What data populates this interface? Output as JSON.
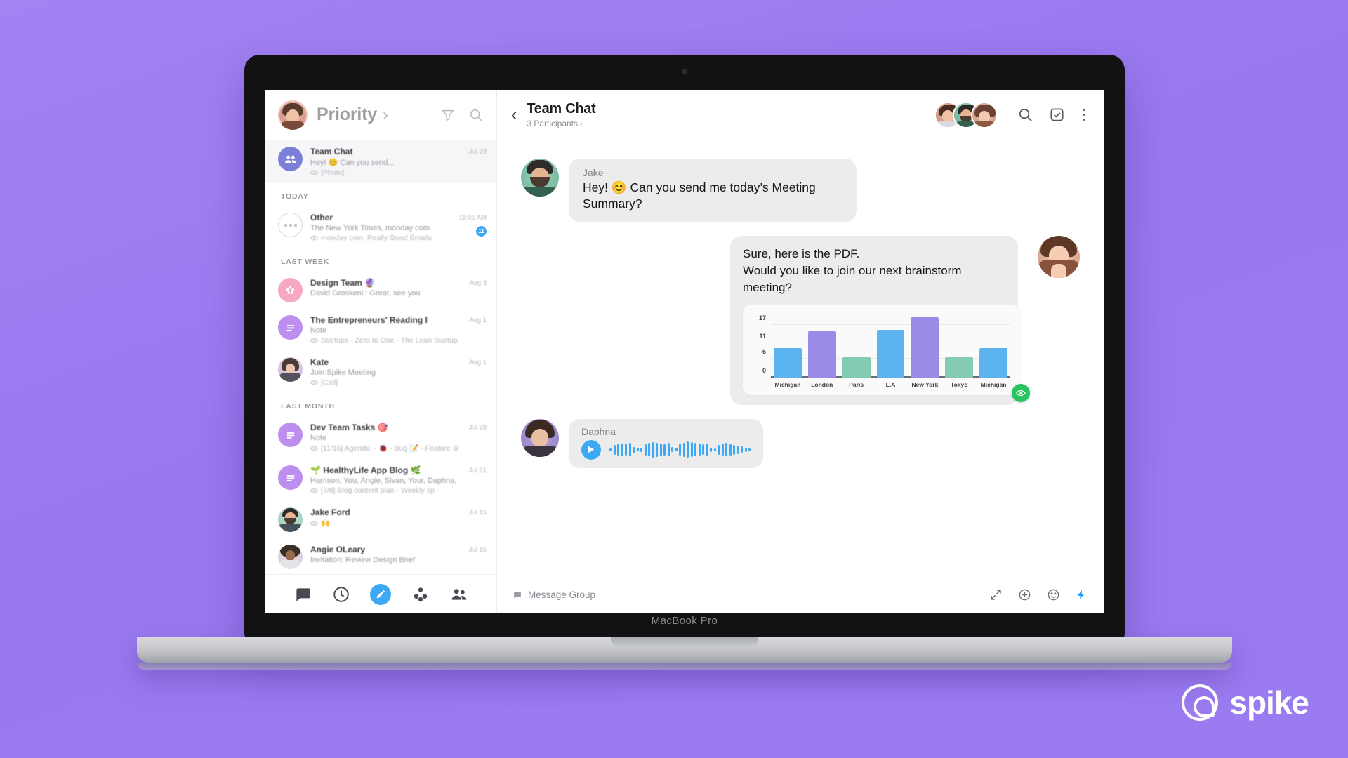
{
  "brand": {
    "name": "spike",
    "logo_icon": "spike-logo-icon"
  },
  "device": {
    "label": "MacBook Pro"
  },
  "colors": {
    "background": "#9b7bf0",
    "accent_blue": "#3da9f5",
    "bar_blue": "#5bb3f0",
    "bar_purple": "#9b8ae6",
    "bar_green": "#83ccb1",
    "seen_green": "#26c560",
    "bubble_gray": "#ececec"
  },
  "sidebar": {
    "header": {
      "title": "Priority",
      "chevron": "›",
      "avatar": "user-avatar",
      "filter_icon": "filter-icon",
      "search_icon": "search-icon"
    },
    "groups": [
      {
        "label": "",
        "items": [
          {
            "name": "Team Chat",
            "preview": "Hey! 😊 Can you send...",
            "attachment": "[Photo]",
            "date": "Jul 29",
            "avatar_type": "group",
            "active": true,
            "badge": ""
          }
        ]
      },
      {
        "label": "TODAY",
        "items": [
          {
            "name": "Other",
            "preview": "The New York Times, monday com",
            "attachment": "monday com, Really Good Emails",
            "date": "11:01 AM",
            "avatar_type": "dots",
            "active": false,
            "badge": "11"
          }
        ]
      },
      {
        "label": "LAST WEEK",
        "items": [
          {
            "name": "Design Team 🔮",
            "preview": "David Groskenl : Great, see you",
            "attachment": "",
            "date": "Aug 3",
            "avatar_type": "pink-group",
            "active": false,
            "badge": ""
          },
          {
            "name": "The Entrepreneurs' Reading l",
            "preview": "Note",
            "attachment": "Startups - Zero to One - The Lean Startup",
            "date": "Aug 1",
            "avatar_type": "note",
            "active": false,
            "badge": ""
          },
          {
            "name": "Kate",
            "preview": "Join Spike Meeting",
            "attachment": "[Call]",
            "date": "Aug 1",
            "avatar_type": "photo-kate",
            "active": false,
            "badge": ""
          }
        ]
      },
      {
        "label": "LAST MONTH",
        "items": [
          {
            "name": "Dev Team Tasks 🎯",
            "preview": "Note",
            "attachment": "[11/16] Agenda: · 🐞 - Bug 📝 - Feature ⚙",
            "date": "Jul 28",
            "avatar_type": "note",
            "active": false,
            "badge": ""
          },
          {
            "name": "🌱 HealthyLife App Blog 🌿",
            "preview": "Harrison, You, Angie, Sivan, Your, Daphna,",
            "attachment": "[7/9] Blog content plan - Weekly tip ·",
            "date": "Jul 21",
            "avatar_type": "note",
            "active": false,
            "badge": ""
          },
          {
            "name": "Jake Ford",
            "preview": "",
            "attachment": "🙌",
            "date": "Jul 15",
            "avatar_type": "photo-jake",
            "active": false,
            "badge": ""
          },
          {
            "name": "Angie OLeary",
            "preview": "Invitation: Review Design Brief",
            "attachment": "",
            "date": "Jul 15",
            "avatar_type": "photo-angie",
            "active": false,
            "badge": ""
          }
        ]
      }
    ],
    "bottom_nav": [
      {
        "icon": "chat-icon",
        "label": "Chat",
        "active": false
      },
      {
        "icon": "clock-icon",
        "label": "Snooze",
        "active": false
      },
      {
        "icon": "compose-icon",
        "label": "Compose",
        "active": true
      },
      {
        "icon": "puzzle-icon",
        "label": "Apps",
        "active": false
      },
      {
        "icon": "contacts-icon",
        "label": "Contacts",
        "active": false
      }
    ]
  },
  "chat": {
    "back_icon": "back-chevron-icon",
    "title": "Team Chat",
    "subtitle": "3 Participants",
    "subtitle_chevron": "›",
    "participants": [
      "participant-avatar-1",
      "participant-avatar-2",
      "participant-avatar-3"
    ],
    "header_icons": [
      {
        "name": "search-icon"
      },
      {
        "name": "task-check-icon"
      },
      {
        "name": "more-options-icon"
      }
    ],
    "messages": [
      {
        "id": "msg-jake",
        "direction": "in",
        "sender": "Jake",
        "avatar": "jake-avatar",
        "text": "Hey! 😊 Can you send me today’s Meeting Summary?"
      },
      {
        "id": "msg-daphna-reply",
        "direction": "out",
        "sender": "",
        "avatar": "daphna-avatar",
        "text": "Sure, here is the PDF.\nWould you like to join our next brainstorm meeting?",
        "has_chart": true,
        "status": "seen"
      },
      {
        "id": "msg-voice",
        "direction": "in",
        "sender": "Daphna",
        "avatar": "daphna-avatar-2",
        "type": "voice",
        "play_icon": "play-icon"
      }
    ],
    "composer": {
      "placeholder": "Message Group",
      "bubble_icon": "message-bubble-icon",
      "icons": [
        {
          "name": "expand-icon"
        },
        {
          "name": "add-attachment-icon"
        },
        {
          "name": "emoji-icon"
        },
        {
          "name": "quick-actions-bolt-icon"
        }
      ]
    }
  },
  "chart_data": {
    "type": "bar",
    "title": "",
    "xlabel": "",
    "ylabel": "",
    "categories": [
      "Michigan",
      "London",
      "Paris",
      "L.A",
      "New York",
      "Tokyo",
      "Michigan"
    ],
    "values": [
      9.5,
      15,
      6.5,
      15.5,
      19.5,
      6.5,
      9.5
    ],
    "colors": [
      "#5bb3f0",
      "#9b8ae6",
      "#83ccb1",
      "#5bb3f0",
      "#9b8ae6",
      "#83ccb1",
      "#5bb3f0"
    ],
    "yticks": [
      0,
      6,
      11,
      17
    ],
    "ylim": [
      0,
      21
    ],
    "grid": true,
    "legend": "none"
  }
}
